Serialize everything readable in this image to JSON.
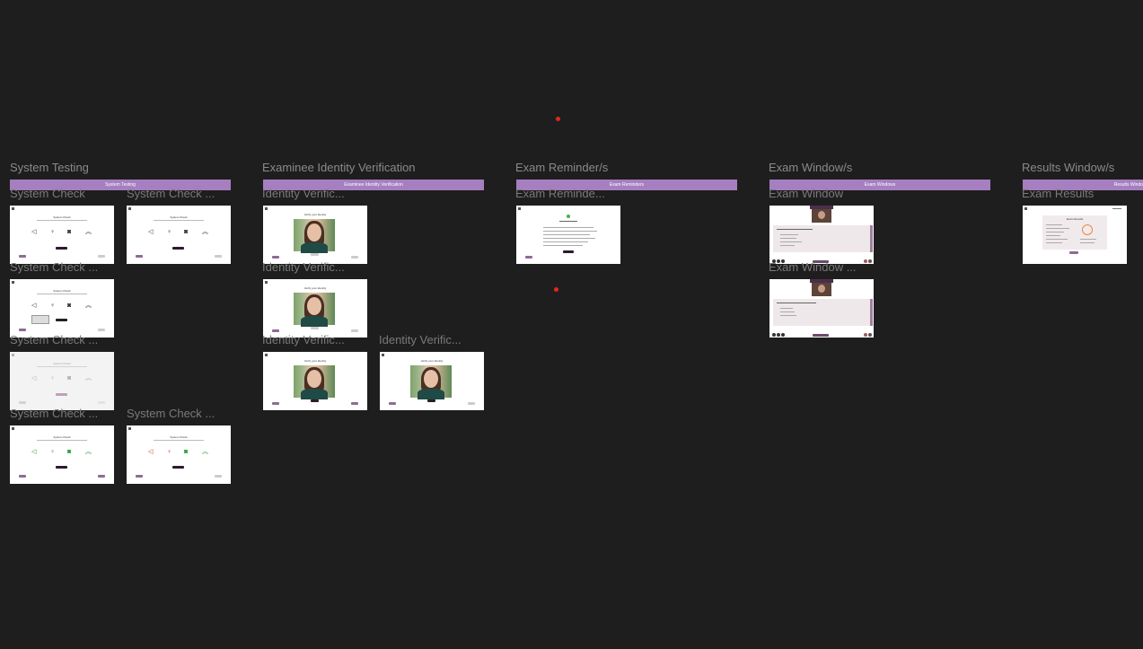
{
  "sections": [
    {
      "title": "System Testing",
      "banner": "System Testing"
    },
    {
      "title": "Examinee Identity Verification",
      "banner": "Examinee Identity Verification"
    },
    {
      "title": "Exam Reminder/s",
      "banner": "Exam Reminders"
    },
    {
      "title": "Exam Window/s",
      "banner": "Exam Windows"
    },
    {
      "title": "Results Window/s",
      "banner": "Results Windo"
    }
  ],
  "frames": {
    "system_check": "System Check",
    "system_check_trunc": "System Check ...",
    "identity_verification": "Identity Verific...",
    "identity_verification_full": "Identity Verific...",
    "exam_reminder": "Exam Reminde...",
    "exam_window": "Exam Window",
    "exam_window_trunc": "Exam Window ...",
    "exam_results": "Exam Results"
  },
  "mini": {
    "system_check_title": "System Check",
    "verify_title": "Verify your identity",
    "results_title": "Exam Results"
  },
  "colors": {
    "canvas": "#1e1e1e",
    "banner": "#a57fc0",
    "frame_label": "#7a7a7a",
    "marker": "#e3261f"
  }
}
